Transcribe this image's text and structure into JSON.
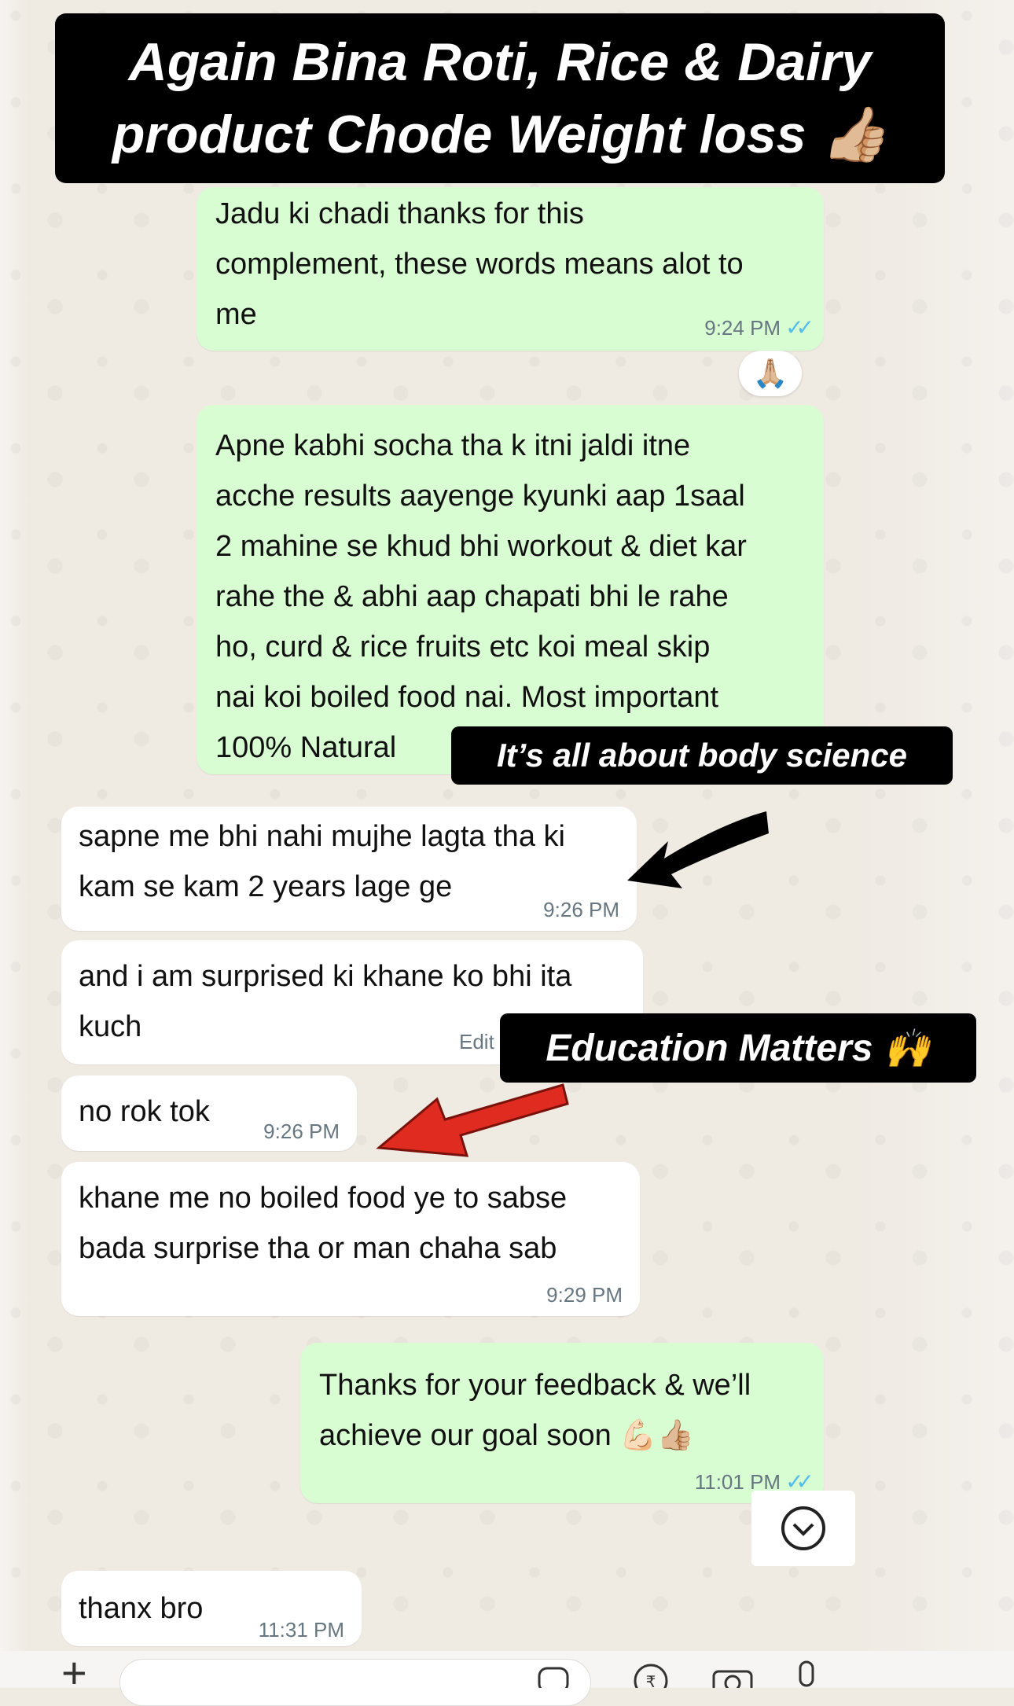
{
  "banner": {
    "line1": "Again Bina Roti, Rice & Dairy",
    "line2": "product Chode Weight loss",
    "emoji": "👍🏼"
  },
  "overlays": {
    "body_science": "It’s all about body science",
    "education": "Education Matters",
    "education_emoji": "🙌"
  },
  "messages": [
    {
      "dir": "out",
      "text": "Jadu ki chadi thanks for this\ncomplement, these words means alot to\nme",
      "time": "9:24 PM",
      "read": true
    },
    {
      "dir": "out",
      "text": "Apne kabhi socha tha k itni jaldi itne\nacche results aayenge kyunki aap 1saal\n2 mahine se khud bhi workout & diet kar\nrahe the & abhi aap chapati bhi le rahe\nho, curd & rice fruits etc koi meal skip\nnai koi boiled food nai. Most important\n100% Natural",
      "time": "",
      "read": false
    },
    {
      "dir": "in",
      "text": "sapne me bhi nahi mujhe lagta tha ki\nkam se kam 2 years lage ge",
      "time": "9:26 PM"
    },
    {
      "dir": "in",
      "text": "and i am surprised ki khane ko bhi ita\nkuch",
      "time": "Edit"
    },
    {
      "dir": "in",
      "text": "no rok tok",
      "time": "9:26 PM"
    },
    {
      "dir": "in",
      "text": "khane me no boiled food ye to sabse\nbada surprise tha or man chaha sab",
      "time": "9:29 PM"
    },
    {
      "dir": "out",
      "text": "Thanks for your feedback & we’ll\nachieve our goal soon 💪🏻👍🏼",
      "time": "11:01 PM",
      "read": true
    },
    {
      "dir": "in",
      "text": "thanx bro",
      "time": "11:31 PM"
    }
  ],
  "reaction": "🙏🏼",
  "ticks": "✓✓",
  "colors": {
    "outgoing": "#d9fdd3",
    "incoming": "#ffffff",
    "read_tick": "#53bdeb",
    "arrow_red": "#e02b20"
  }
}
